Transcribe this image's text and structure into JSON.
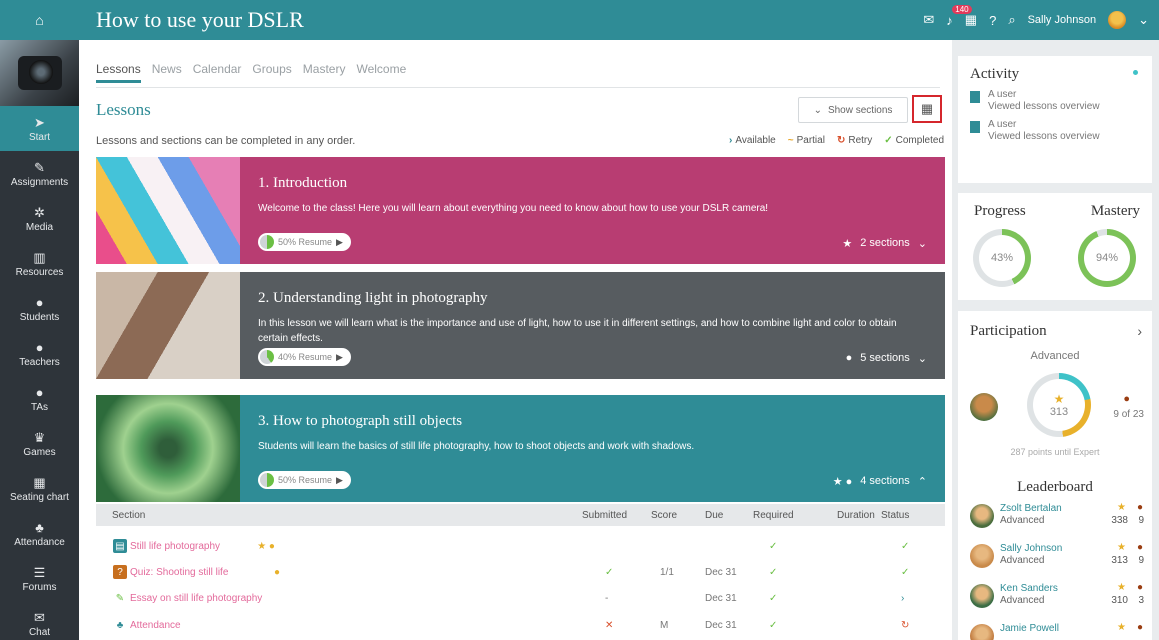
{
  "header": {
    "title": "How to use your DSLR",
    "notifications": "140",
    "user": "Sally Johnson"
  },
  "sidebar": {
    "items": [
      {
        "label": "Start",
        "icon": "send-icon",
        "glyph": "➤"
      },
      {
        "label": "Assignments",
        "icon": "assignments-icon",
        "glyph": "✎"
      },
      {
        "label": "Media",
        "icon": "media-icon",
        "glyph": "✲"
      },
      {
        "label": "Resources",
        "icon": "resources-icon",
        "glyph": "▥"
      },
      {
        "label": "Students",
        "icon": "students-icon",
        "glyph": "●"
      },
      {
        "label": "Teachers",
        "icon": "teachers-icon",
        "glyph": "●"
      },
      {
        "label": "TAs",
        "icon": "tas-icon",
        "glyph": "●"
      },
      {
        "label": "Games",
        "icon": "trophy-icon",
        "glyph": "♛"
      },
      {
        "label": "Seating chart",
        "icon": "seating-icon",
        "glyph": "▦"
      },
      {
        "label": "Attendance",
        "icon": "attendance-icon",
        "glyph": "♣"
      },
      {
        "label": "Forums",
        "icon": "forums-icon",
        "glyph": "☰"
      },
      {
        "label": "Chat",
        "icon": "chat-icon",
        "glyph": "✉"
      }
    ]
  },
  "tabs": [
    "Lessons",
    "News",
    "Calendar",
    "Groups",
    "Mastery",
    "Welcome"
  ],
  "lessons": {
    "heading": "Lessons",
    "show_sections": "Show sections",
    "info": "Lessons and sections can be completed in any order.",
    "legend": [
      {
        "icon": "›",
        "label": "Available"
      },
      {
        "icon": "~",
        "label": "Partial"
      },
      {
        "icon": "↻",
        "label": "Retry"
      },
      {
        "icon": "✓",
        "label": "Completed"
      }
    ],
    "cards": [
      {
        "title": "1. Introduction",
        "desc": "Welcome to the class! Here you will learn about everything you need to know about how to use your DSLR camera!",
        "resume": "50% Resume",
        "progress": 50,
        "sections": "2 sections",
        "color": "#b83d72",
        "markers": "★"
      },
      {
        "title": "2. Understanding light in photography",
        "desc": "In this lesson we will learn what is the importance and use of light, how to use it in different settings, and how to combine light and color to obtain certain effects.",
        "resume": "40% Resume",
        "progress": 40,
        "sections": "5 sections",
        "color": "#575c60",
        "markers": "●"
      },
      {
        "title": "3. How to photograph still objects",
        "desc": "Students will learn the basics of still life photography, how to shoot objects and work with shadows.",
        "resume": "50% Resume",
        "progress": 50,
        "sections": "4 sections",
        "color": "#2f8c96",
        "markers": "★ ●"
      }
    ]
  },
  "table": {
    "headers": [
      "Section",
      "Submitted",
      "Score",
      "Due",
      "Required",
      "Duration",
      "Status"
    ],
    "rows": [
      {
        "name": "Still life photography",
        "submitted": "",
        "score": "",
        "due": "",
        "required": "✓",
        "duration": "",
        "status": "✓"
      },
      {
        "name": "Quiz: Shooting still life",
        "submitted": "✓",
        "score": "1/1",
        "due": "Dec 31",
        "required": "✓",
        "duration": "",
        "status": "✓"
      },
      {
        "name": "Essay on still life photography",
        "submitted": "-",
        "score": "",
        "due": "Dec 31",
        "required": "✓",
        "duration": "",
        "status": "›"
      },
      {
        "name": "Attendance",
        "submitted": "✕",
        "score": "M",
        "due": "Dec 31",
        "required": "✓",
        "duration": "",
        "status": "↻"
      }
    ]
  },
  "activity": {
    "title": "Activity",
    "items": [
      {
        "user": "A user",
        "action": "Viewed lessons overview"
      },
      {
        "user": "A user",
        "action": "Viewed lessons overview"
      }
    ]
  },
  "progress": {
    "label": "Progress",
    "value": "43%",
    "pct": 43
  },
  "mastery": {
    "label": "Mastery",
    "value": "94%",
    "pct": 94
  },
  "participation": {
    "title": "Participation",
    "level": "Advanced",
    "points": "313",
    "badges": "9 of 23",
    "until": "287 points until Expert"
  },
  "leaderboard": {
    "title": "Leaderboard",
    "rows": [
      {
        "name": "Zsolt Bertalan",
        "level": "Advanced",
        "points": "338",
        "badges": "9"
      },
      {
        "name": "Sally Johnson",
        "level": "Advanced",
        "points": "313",
        "badges": "9"
      },
      {
        "name": "Ken Sanders",
        "level": "Advanced",
        "points": "310",
        "badges": "3"
      },
      {
        "name": "Jamie Powell",
        "level": "",
        "points": "",
        "badges": ""
      }
    ]
  }
}
